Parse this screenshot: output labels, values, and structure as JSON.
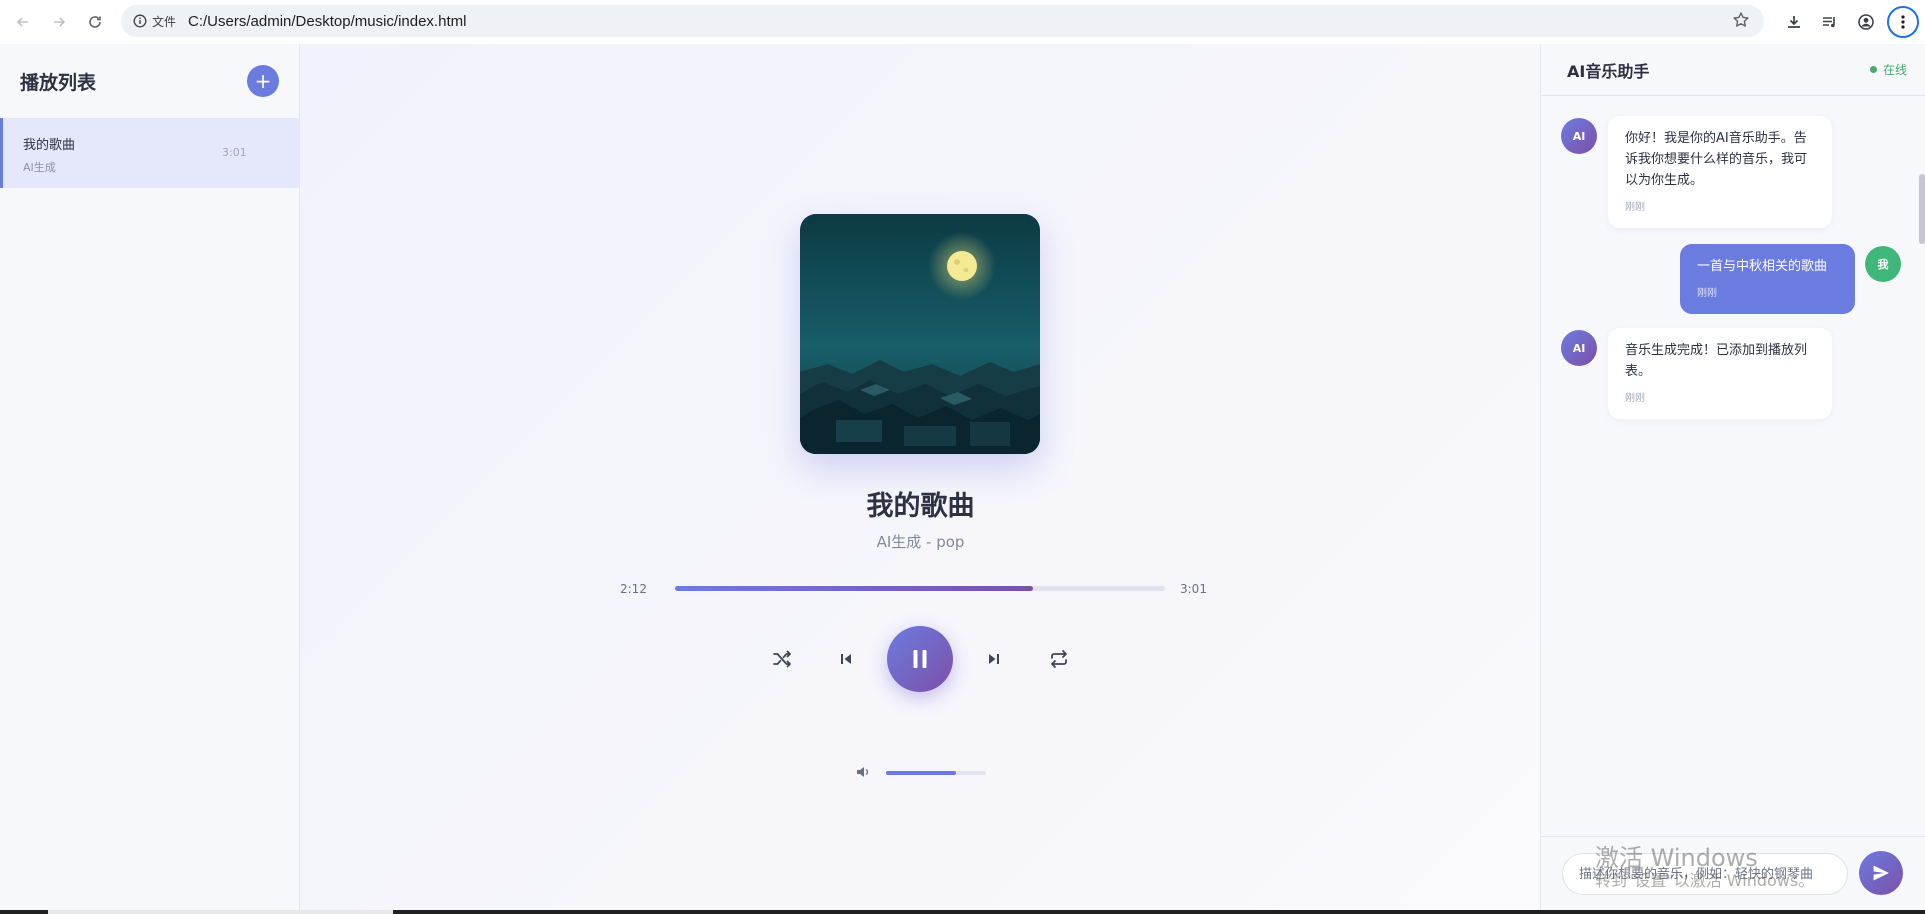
{
  "browser": {
    "site_label": "文件",
    "url": "C:/Users/admin/Desktop/music/index.html"
  },
  "playlist": {
    "title": "播放列表",
    "add_symbol": "+",
    "items": [
      {
        "name": "我的歌曲",
        "artist": "AI生成",
        "duration": "3:01"
      }
    ]
  },
  "player": {
    "song_title": "我的歌曲",
    "song_subtitle": "AI生成 - pop",
    "current_time": "2:12",
    "total_time": "3:01",
    "progress_percent": 73,
    "volume_percent": 70,
    "is_playing": true
  },
  "assistant": {
    "title": "AI音乐助手",
    "status": "在线",
    "messages": [
      {
        "sender": "ai",
        "avatar": "AI",
        "text": "你好！我是你的AI音乐助手。告诉我你想要什么样的音乐，我可以为你生成。",
        "time": "刚刚"
      },
      {
        "sender": "me",
        "avatar": "我",
        "text": "一首与中秋相关的歌曲",
        "time": "刚刚"
      },
      {
        "sender": "ai",
        "avatar": "AI",
        "text": "音乐生成完成！已添加到播放列表。",
        "time": "刚刚"
      }
    ],
    "input_placeholder": "描述你想要的音乐，例如：轻快的钢琴曲"
  },
  "watermark": {
    "line1": "激活 Windows",
    "line2": "转到\"设置\"以激活 Windows。"
  },
  "colors": {
    "accent": "#6b7ce0",
    "accent_dark": "#7d4fa8",
    "online": "#3fae6b",
    "user_avatar": "#3fb67a"
  }
}
